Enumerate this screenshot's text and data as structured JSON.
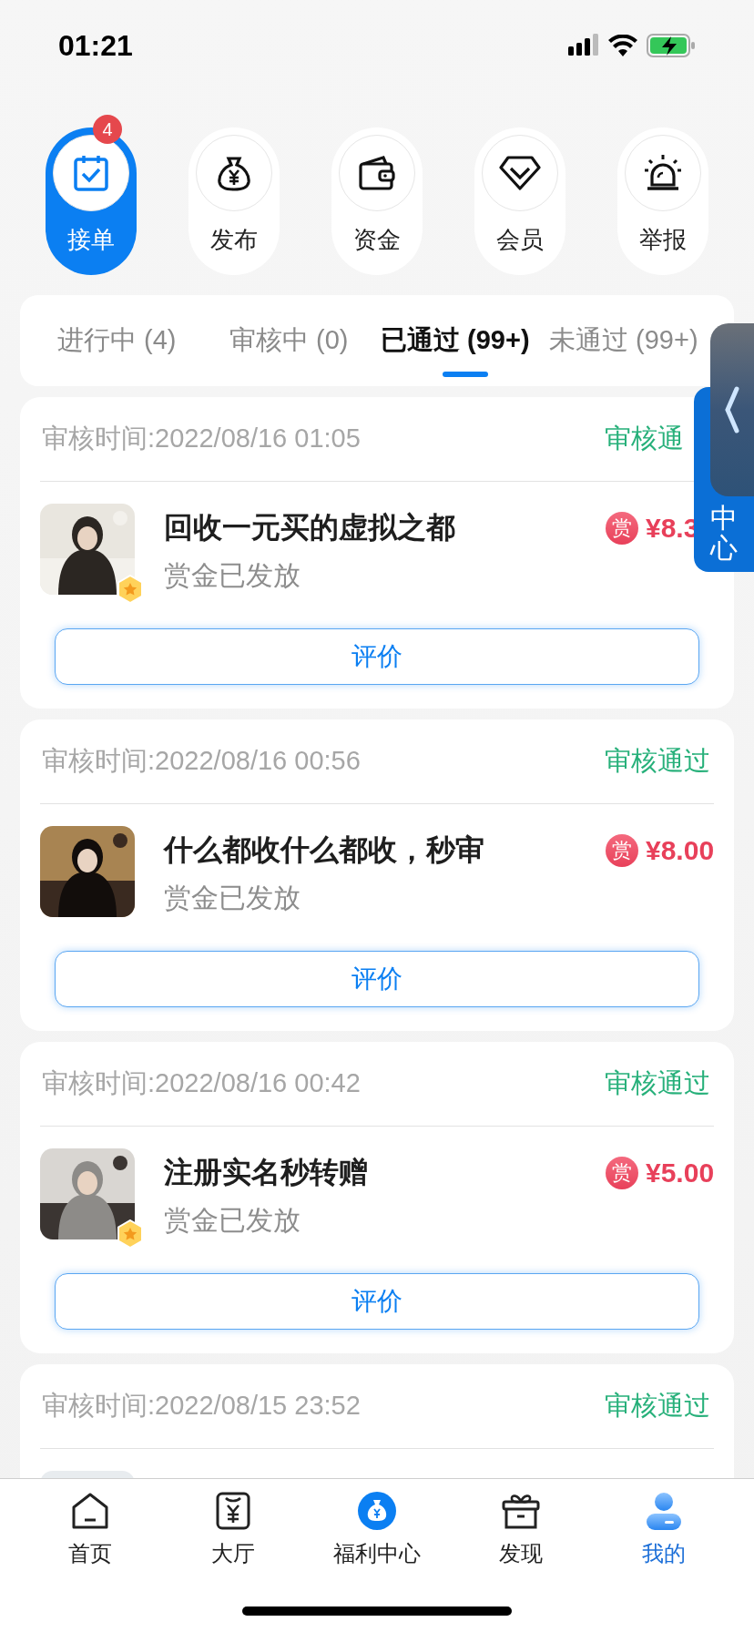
{
  "status_bar": {
    "time": "01:21"
  },
  "actions": [
    {
      "label": "接单",
      "selected": true,
      "badge": "4"
    },
    {
      "label": "发布",
      "selected": false
    },
    {
      "label": "资金",
      "selected": false
    },
    {
      "label": "会员",
      "selected": false
    },
    {
      "label": "举报",
      "selected": false
    }
  ],
  "tabs": [
    {
      "label": "进行中 (4)",
      "selected": false
    },
    {
      "label": "审核中 (0)",
      "selected": false
    },
    {
      "label": "已通过 (99+)",
      "selected": true
    },
    {
      "label": "未通过 (99+)",
      "selected": false
    }
  ],
  "cards": [
    {
      "review_time": "审核时间:2022/08/16 01:05",
      "status": "审核通",
      "vip": true,
      "title": "回收一元买的虚拟之都",
      "reward_mark": "赏",
      "price": "¥8.3",
      "subtitle": "赏金已发放",
      "button": "评价"
    },
    {
      "review_time": "审核时间:2022/08/16 00:56",
      "status": "审核通过",
      "vip": false,
      "title": "什么都收什么都收，秒审",
      "reward_mark": "赏",
      "price": "¥8.00",
      "subtitle": "赏金已发放",
      "button": "评价"
    },
    {
      "review_time": "审核时间:2022/08/16 00:42",
      "status": "审核通过",
      "vip": true,
      "title": "注册实名秒转赠",
      "reward_mark": "赏",
      "price": "¥5.00",
      "subtitle": "赏金已发放",
      "button": "评价"
    },
    {
      "review_time": "审核时间:2022/08/15 23:52",
      "status": "审核通过",
      "vip": false
    }
  ],
  "side_tab": {
    "label": "中心"
  },
  "bottom_nav": [
    {
      "label": "首页",
      "selected": false
    },
    {
      "label": "大厅",
      "selected": false
    },
    {
      "label": "福利中心",
      "selected": false
    },
    {
      "label": "发现",
      "selected": false
    },
    {
      "label": "我的",
      "selected": true
    }
  ]
}
